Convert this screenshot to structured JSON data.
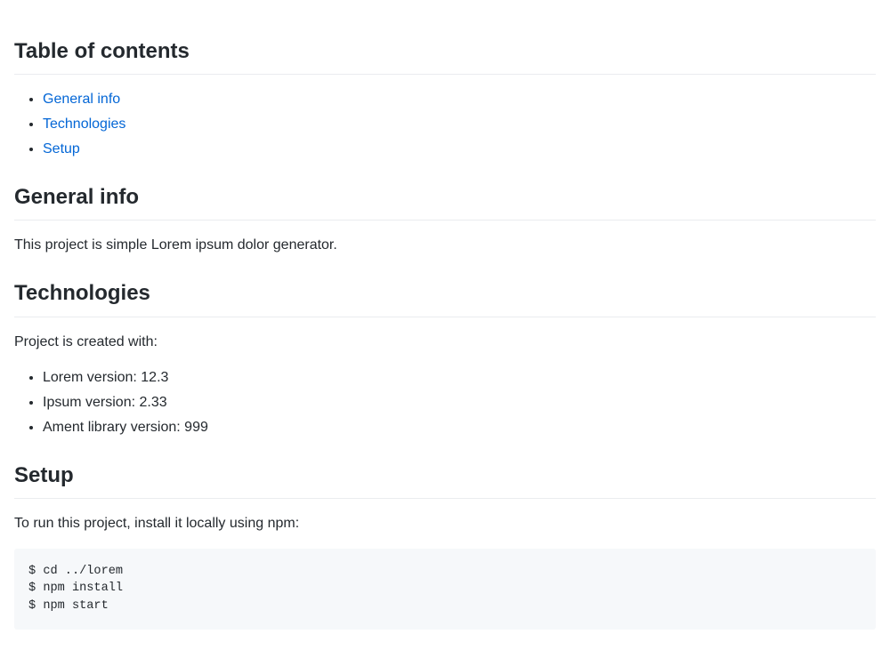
{
  "toc": {
    "heading": "Table of contents",
    "items": [
      {
        "label": "General info"
      },
      {
        "label": "Technologies"
      },
      {
        "label": "Setup"
      }
    ]
  },
  "general_info": {
    "heading": "General info",
    "body": "This project is simple Lorem ipsum dolor generator."
  },
  "technologies": {
    "heading": "Technologies",
    "intro": "Project is created with:",
    "items": [
      "Lorem version: 12.3",
      "Ipsum version: 2.33",
      "Ament library version: 999"
    ]
  },
  "setup": {
    "heading": "Setup",
    "intro": "To run this project, install it locally using npm:",
    "code": "$ cd ../lorem\n$ npm install\n$ npm start"
  }
}
